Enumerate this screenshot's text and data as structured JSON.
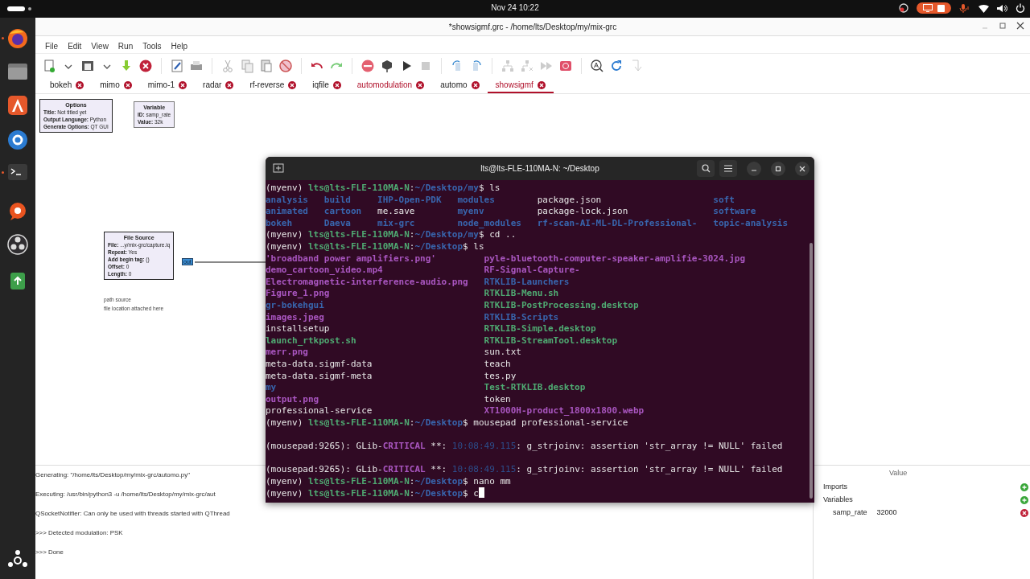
{
  "top_bar": {
    "clock": "Nov 24  10:22"
  },
  "grc": {
    "title": "*showsigmf.grc - /home/lts/Desktop/my/mix-grc",
    "menu": [
      "File",
      "Edit",
      "View",
      "Run",
      "Tools",
      "Help"
    ],
    "tabs": [
      {
        "label": "bokeh",
        "selected": false,
        "modified": false
      },
      {
        "label": "mimo",
        "selected": false,
        "modified": false
      },
      {
        "label": "mimo-1",
        "selected": false,
        "modified": false
      },
      {
        "label": "radar",
        "selected": false,
        "modified": false
      },
      {
        "label": "rf-reverse",
        "selected": false,
        "modified": false
      },
      {
        "label": "iqfile",
        "selected": false,
        "modified": false
      },
      {
        "label": "automodulation",
        "selected": false,
        "modified": true
      },
      {
        "label": "automo",
        "selected": false,
        "modified": false
      },
      {
        "label": "showsigmf",
        "selected": true,
        "modified": true
      }
    ],
    "blocks": [
      {
        "kind": "options",
        "title": "Options",
        "params": [
          {
            "name": "Title:",
            "value": "Not titled yet"
          },
          {
            "name": "Output Language:",
            "value": "Python"
          },
          {
            "name": "Generate Options:",
            "value": "QT GUI"
          }
        ]
      },
      {
        "kind": "variable",
        "title": "Variable",
        "params": [
          {
            "name": "ID:",
            "value": "samp_rate"
          },
          {
            "name": "Value:",
            "value": "32k"
          }
        ]
      },
      {
        "kind": "source",
        "title": "File Source",
        "port": "out",
        "params": [
          {
            "name": "File:",
            "value": "...y/mix-grc/capture.iq"
          },
          {
            "name": "Repeat:",
            "value": "Yes"
          },
          {
            "name": "Add begin tag:",
            "value": "()"
          },
          {
            "name": "Offset:",
            "value": "0"
          },
          {
            "name": "Length:",
            "value": "0"
          }
        ],
        "comment": [
          "path source",
          "file location attached here"
        ]
      }
    ],
    "console": [
      "Generating: \"/home/lts/Desktop/my/mix-grc/automo.py\"",
      "Executing: /usr/bin/python3 -u /home/lts/Desktop/my/mix-grc/aut",
      "QSocketNotifier: Can only be used with threads started with QThread",
      ">>> Detected modulation: PSK",
      ">>> Done"
    ],
    "variables_panel": {
      "column": "Value",
      "items": [
        {
          "label": "Imports",
          "kind": "add"
        },
        {
          "label": "Variables",
          "kind": "add",
          "children": [
            {
              "label": "samp_rate",
              "value": "32000",
              "kind": "remove"
            }
          ]
        }
      ]
    }
  },
  "terminal": {
    "title": "lts@lts-FLE-110MA-N: ~/Desktop",
    "blocks": [
      {
        "kind": "line",
        "segments": [
          {
            "text": "(myenv) ",
            "kind": "plain"
          },
          {
            "text": "lts@lts-FLE-110MA-N",
            "kind": "user"
          },
          {
            "text": ":",
            "kind": "plain"
          },
          {
            "text": "~/Desktop/my",
            "kind": "path"
          },
          {
            "text": "$ ls",
            "kind": "plain"
          }
        ]
      },
      {
        "kind": "listing",
        "rows": [
          [
            {
              "text": "analysis",
              "kind": "dir"
            },
            {
              "text": "build",
              "kind": "dir"
            },
            {
              "text": "IHP-Open-PDK",
              "kind": "dir"
            },
            {
              "text": "modules",
              "kind": "dir"
            },
            {
              "text": "package.json",
              "kind": "file"
            },
            {
              "text": "soft",
              "kind": "dir"
            }
          ],
          [
            {
              "text": "animated",
              "kind": "dir"
            },
            {
              "text": "cartoon",
              "kind": "dir"
            },
            {
              "text": "me.save",
              "kind": "file"
            },
            {
              "text": "myenv",
              "kind": "dir"
            },
            {
              "text": "package-lock.json",
              "kind": "file"
            },
            {
              "text": "software",
              "kind": "dir"
            }
          ],
          [
            {
              "text": "bokeh",
              "kind": "dir"
            },
            {
              "text": "Daeva",
              "kind": "dir"
            },
            {
              "text": "mix-grc",
              "kind": "dir"
            },
            {
              "text": "node_modules",
              "kind": "dir"
            },
            {
              "text": "rf-scan-AI-ML-DL-Professional-",
              "kind": "dir"
            },
            {
              "text": "topic-analysis",
              "kind": "dir"
            }
          ]
        ]
      },
      {
        "kind": "line",
        "segments": [
          {
            "text": "(myenv) ",
            "kind": "plain"
          },
          {
            "text": "lts@lts-FLE-110MA-N",
            "kind": "user"
          },
          {
            "text": ":",
            "kind": "plain"
          },
          {
            "text": "~/Desktop/my",
            "kind": "path"
          },
          {
            "text": "$ cd ..",
            "kind": "plain"
          }
        ]
      },
      {
        "kind": "line",
        "segments": [
          {
            "text": "(myenv) ",
            "kind": "plain"
          },
          {
            "text": "lts@lts-FLE-110MA-N",
            "kind": "user"
          },
          {
            "text": ":",
            "kind": "plain"
          },
          {
            "text": "~/Desktop",
            "kind": "path"
          },
          {
            "text": "$ ls",
            "kind": "plain"
          }
        ]
      },
      {
        "kind": "listing",
        "rows": [
          [
            {
              "text": "'broadband power amplifiers.png'",
              "kind": "image"
            },
            {
              "text": "pyle-bluetooth-computer-speaker-amplifie-3024.jpg",
              "kind": "image"
            }
          ],
          [
            {
              "text": "demo_cartoon_video.mp4",
              "kind": "image"
            },
            {
              "text": "RF-Signal-Capture-",
              "kind": "image"
            }
          ],
          [
            {
              "text": "Electromagnetic-interference-audio.png",
              "kind": "image"
            },
            {
              "text": "RTKLIB-Launchers",
              "kind": "dir"
            }
          ],
          [
            {
              "text": "Figure_1.png",
              "kind": "image"
            },
            {
              "text": "RTKLIB-Menu.sh",
              "kind": "exec"
            }
          ],
          [
            {
              "text": "gr-bokehgui",
              "kind": "dir"
            },
            {
              "text": "RTKLIB-PostProcessing.desktop",
              "kind": "exec"
            }
          ],
          [
            {
              "text": "images.jpeg",
              "kind": "image"
            },
            {
              "text": "RTKLIB-Scripts",
              "kind": "dir"
            }
          ],
          [
            {
              "text": "installsetup",
              "kind": "file"
            },
            {
              "text": "RTKLIB-Simple.desktop",
              "kind": "exec"
            }
          ],
          [
            {
              "text": "launch_rtkpost.sh",
              "kind": "exec"
            },
            {
              "text": "RTKLIB-StreamTool.desktop",
              "kind": "exec"
            }
          ],
          [
            {
              "text": "merr.png",
              "kind": "image"
            },
            {
              "text": "sun.txt",
              "kind": "file"
            }
          ],
          [
            {
              "text": "meta-data.sigmf-data",
              "kind": "file"
            },
            {
              "text": "teach",
              "kind": "file"
            }
          ],
          [
            {
              "text": "meta-data.sigmf-meta",
              "kind": "file"
            },
            {
              "text": "tes.py",
              "kind": "file"
            }
          ],
          [
            {
              "text": "my",
              "kind": "dir"
            },
            {
              "text": "Test-RTKLIB.desktop",
              "kind": "exec"
            }
          ],
          [
            {
              "text": "output.png",
              "kind": "image"
            },
            {
              "text": "token",
              "kind": "file"
            }
          ],
          [
            {
              "text": "professional-service",
              "kind": "file"
            },
            {
              "text": "XT1000H-product_1800x1800.webp",
              "kind": "image"
            }
          ]
        ]
      },
      {
        "kind": "line",
        "segments": [
          {
            "text": "(myenv) ",
            "kind": "plain"
          },
          {
            "text": "lts@lts-FLE-110MA-N",
            "kind": "user"
          },
          {
            "text": ":",
            "kind": "plain"
          },
          {
            "text": "~/Desktop",
            "kind": "path"
          },
          {
            "text": "$ mousepad professional-service",
            "kind": "plain"
          }
        ]
      },
      {
        "kind": "blank"
      },
      {
        "kind": "line",
        "segments": [
          {
            "text": "(mousepad:9265): GLib-",
            "kind": "plain"
          },
          {
            "text": "CRITICAL",
            "kind": "critical"
          },
          {
            "text": " **: ",
            "kind": "plain"
          },
          {
            "text": "10:08:49.115",
            "kind": "time"
          },
          {
            "text": ": g_strjoinv: assertion 'str_array != NULL' failed",
            "kind": "plain"
          }
        ]
      },
      {
        "kind": "blank"
      },
      {
        "kind": "line",
        "segments": [
          {
            "text": "(mousepad:9265): GLib-",
            "kind": "plain"
          },
          {
            "text": "CRITICAL",
            "kind": "critical"
          },
          {
            "text": " **: ",
            "kind": "plain"
          },
          {
            "text": "10:08:49.115",
            "kind": "time"
          },
          {
            "text": ": g_strjoinv: assertion 'str_array != NULL' failed",
            "kind": "plain"
          }
        ]
      },
      {
        "kind": "line",
        "segments": [
          {
            "text": "(myenv) ",
            "kind": "plain"
          },
          {
            "text": "lts@lts-FLE-110MA-N",
            "kind": "user"
          },
          {
            "text": ":",
            "kind": "plain"
          },
          {
            "text": "~/Desktop",
            "kind": "path"
          },
          {
            "text": "$ nano mm",
            "kind": "plain"
          }
        ]
      },
      {
        "kind": "line",
        "segments": [
          {
            "text": "(myenv) ",
            "kind": "plain"
          },
          {
            "text": "lts@lts-FLE-110MA-N",
            "kind": "user"
          },
          {
            "text": ":",
            "kind": "plain"
          },
          {
            "text": "~/Desktop",
            "kind": "path"
          },
          {
            "text": "$ c",
            "kind": "plain"
          }
        ]
      }
    ]
  }
}
